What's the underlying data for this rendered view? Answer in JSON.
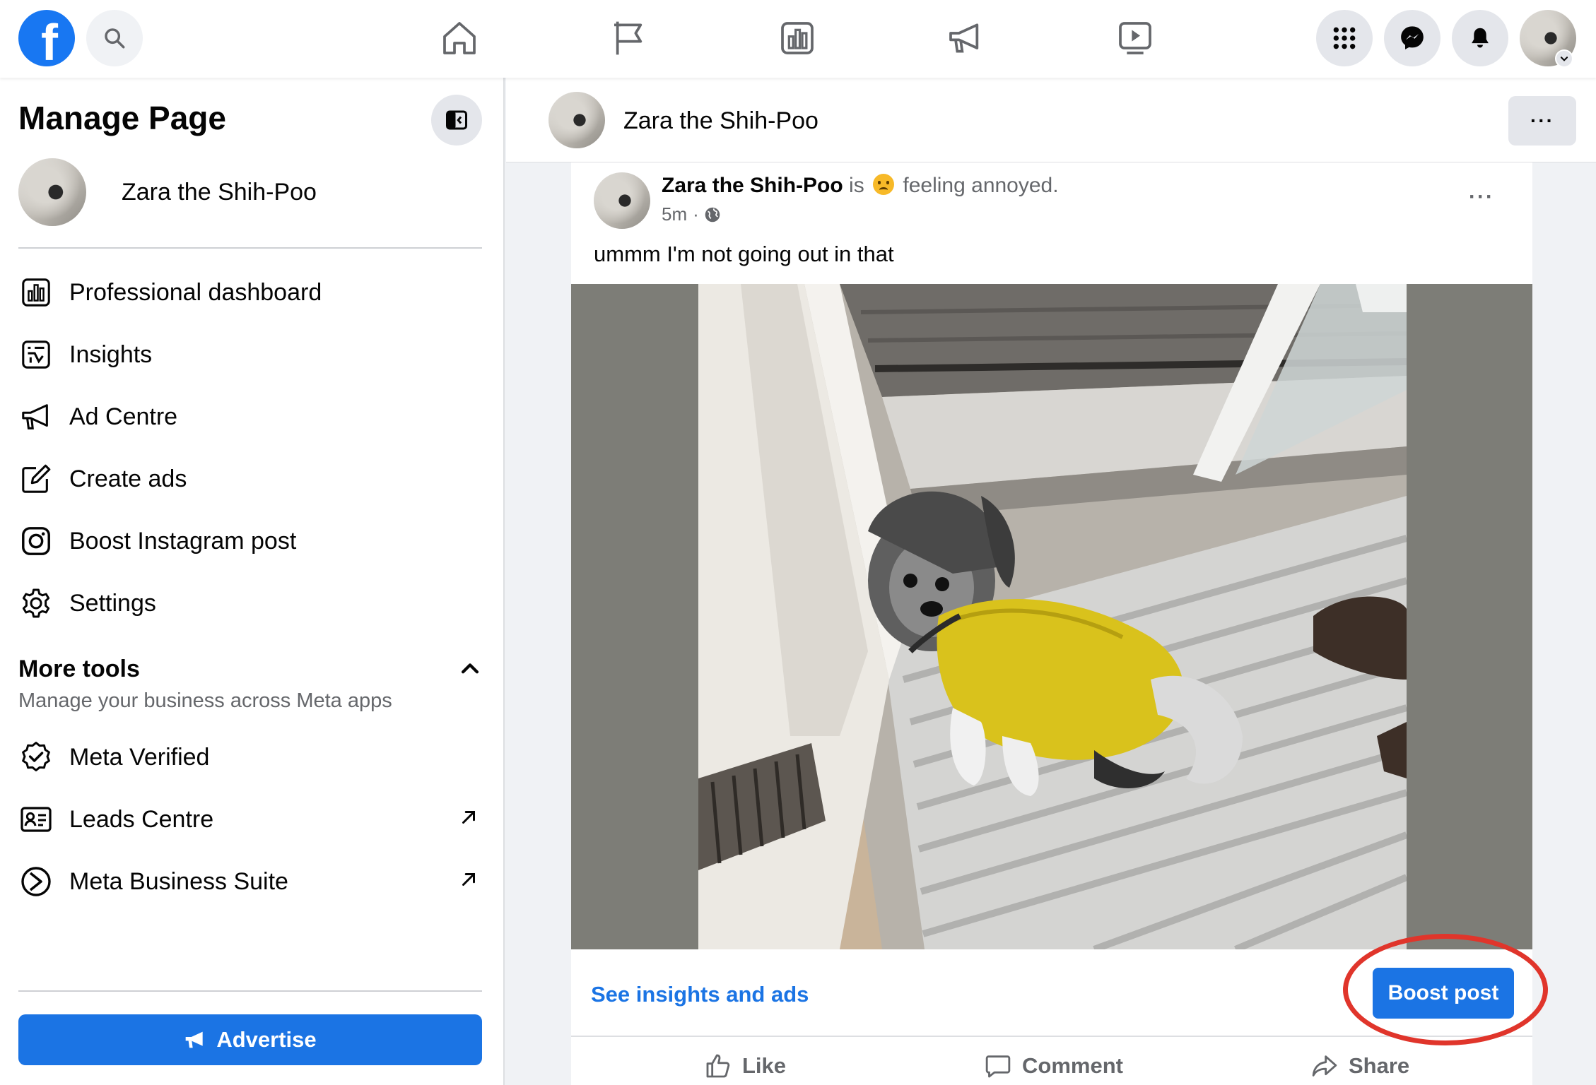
{
  "topbar": {
    "logo": "f",
    "icons": [
      "search-icon",
      "home-icon",
      "pages-flag-icon",
      "dashboard-icon",
      "ad-centre-megaphone-icon",
      "video-icon",
      "menu-grid-icon",
      "messenger-icon",
      "notifications-bell-icon",
      "account-avatar"
    ],
    "brand_color": "#1877f2"
  },
  "sidebar": {
    "title": "Manage Page",
    "page_name": "Zara the Shih-Poo",
    "items": [
      {
        "label": "Professional dashboard",
        "icon": "dashboard-icon"
      },
      {
        "label": "Insights",
        "icon": "insights-icon"
      },
      {
        "label": "Ad Centre",
        "icon": "megaphone-icon"
      },
      {
        "label": "Create ads",
        "icon": "edit-icon"
      },
      {
        "label": "Boost Instagram post",
        "icon": "instagram-icon"
      },
      {
        "label": "Settings",
        "icon": "gear-icon"
      }
    ],
    "more_tools": {
      "title": "More tools",
      "subtitle": "Manage your business across Meta apps",
      "items": [
        {
          "label": "Meta Verified",
          "icon": "verified-badge-icon"
        },
        {
          "label": "Leads Centre",
          "icon": "leads-card-icon",
          "external": true
        },
        {
          "label": "Meta Business Suite",
          "icon": "business-suite-icon",
          "external": true
        }
      ]
    },
    "advertise_label": "Advertise"
  },
  "page_header": {
    "name": "Zara the Shih-Poo",
    "more": "···"
  },
  "post": {
    "author": "Zara the Shih-Poo",
    "is": "is",
    "feeling": "feeling annoyed.",
    "time": "5m",
    "separator": "·",
    "audience": "public-globe-icon",
    "text": "ummm I'm not going out in that",
    "more": "···",
    "see_insights": "See insights and ads",
    "boost_label": "Boost post",
    "actions": {
      "like": "Like",
      "comment": "Comment",
      "share": "Share"
    },
    "accent": "#1b74e4",
    "highlight_color": "#e0352b"
  }
}
